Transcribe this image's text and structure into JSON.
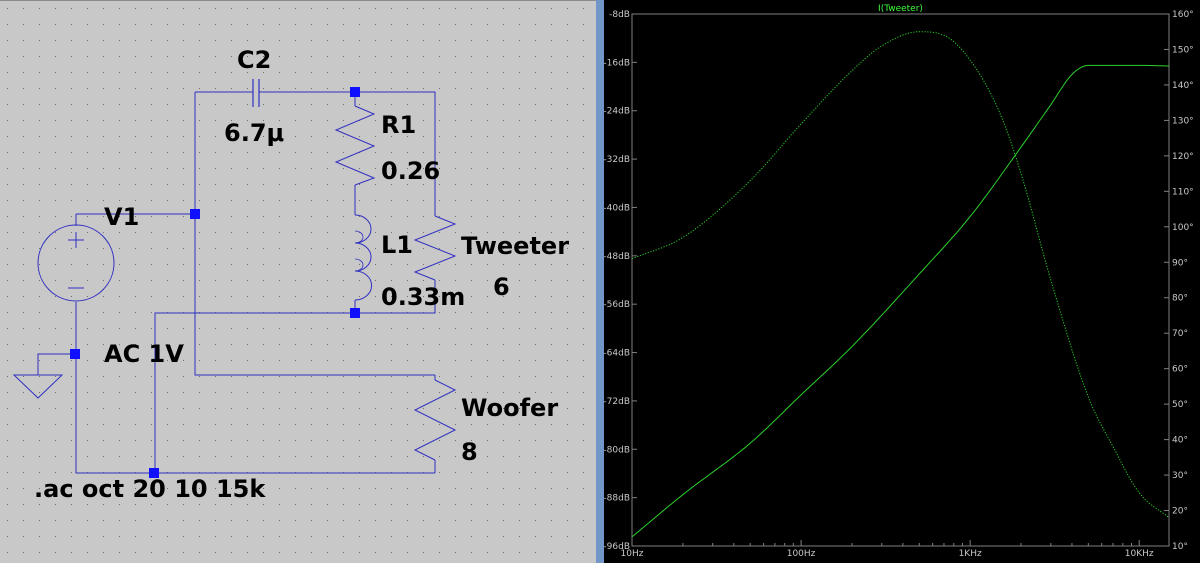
{
  "schematic": {
    "components": {
      "c2": {
        "name": "C2",
        "value": "6.7μ"
      },
      "r1": {
        "name": "R1",
        "value": "0.26"
      },
      "l1": {
        "name": "L1",
        "value": "0.33m"
      },
      "v1": {
        "name": "V1",
        "value": "AC 1V"
      },
      "tweeter": {
        "name": "Tweeter",
        "value": "6"
      },
      "woofer": {
        "name": "Woofer",
        "value": "8"
      }
    },
    "directive": ".ac oct 20 10 15k",
    "colors": {
      "background": "#c8c8c8",
      "wire": "#3030c0",
      "junction": "#1010ff",
      "text": "#000000"
    }
  },
  "plot": {
    "trace_label": "I(Tweeter)",
    "colors": {
      "background": "#000000",
      "trace": "#2ad12a",
      "axis": "#808080",
      "grid": "#333333"
    },
    "chart_data": {
      "type": "line",
      "title": "I(Tweeter)",
      "x_scale": "log",
      "xlim": [
        10,
        15000
      ],
      "x_ticks": [
        "10Hz",
        "100Hz",
        "1KHz",
        "10KHz"
      ],
      "y_left_ticks": [
        "-8dB",
        "-16dB",
        "-24dB",
        "-32dB",
        "-40dB",
        "-48dB",
        "-56dB",
        "-64dB",
        "-72dB",
        "-80dB",
        "-88dB",
        "-96dB"
      ],
      "y_right_ticks": [
        "160°",
        "150°",
        "140°",
        "130°",
        "120°",
        "110°",
        "100°",
        "90°",
        "80°",
        "70°",
        "60°",
        "50°",
        "40°",
        "30°",
        "20°",
        "10°"
      ],
      "ylim_left_db": [
        -96,
        -8
      ],
      "ylim_right_deg": [
        10,
        160
      ],
      "grid": false,
      "series": [
        {
          "style": "solid",
          "axis": "left",
          "x": [
            10,
            20,
            50,
            100,
            200,
            500,
            1000,
            2000,
            3000,
            4000,
            5000,
            7000,
            10000,
            15000
          ],
          "y": [
            -94.5,
            -87.5,
            -79,
            -71,
            -63,
            -51,
            -41.5,
            -30,
            -23,
            -18,
            -16.5,
            -16.5,
            -16.5,
            -16.6
          ]
        },
        {
          "style": "dotted",
          "axis": "right",
          "x": [
            10,
            20,
            50,
            100,
            200,
            300,
            500,
            700,
            1000,
            1500,
            2000,
            3000,
            5000,
            7000,
            10000,
            15000
          ],
          "y": [
            91,
            97,
            113,
            129,
            144,
            151,
            155,
            154,
            147,
            132,
            115,
            85,
            52,
            38,
            25,
            18
          ]
        }
      ]
    }
  }
}
